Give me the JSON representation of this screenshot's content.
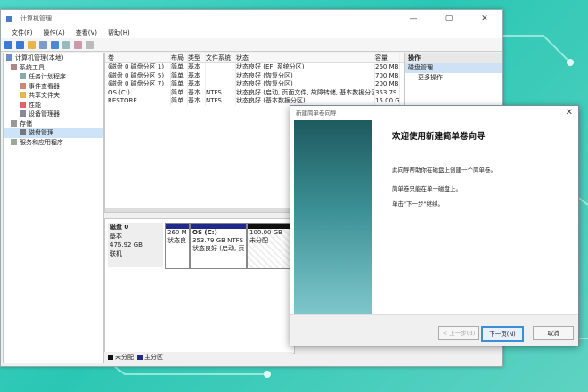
{
  "window": {
    "title": "计算机管理",
    "controls": [
      "—",
      "▢",
      "✕"
    ]
  },
  "menu": [
    "文件(F)",
    "操作(A)",
    "查看(V)",
    "帮助(H)"
  ],
  "tree": [
    {
      "label": "计算机管理(本地)",
      "level": 0,
      "icon": "computer-icon"
    },
    {
      "label": "系统工具",
      "level": 1,
      "icon": "tools-icon"
    },
    {
      "label": "任务计划程序",
      "level": 2,
      "icon": "clock-icon"
    },
    {
      "label": "事件查看器",
      "level": 2,
      "icon": "event-icon"
    },
    {
      "label": "共享文件夹",
      "level": 2,
      "icon": "folder-icon"
    },
    {
      "label": "性能",
      "level": 2,
      "icon": "performance-icon"
    },
    {
      "label": "设备管理器",
      "level": 2,
      "icon": "device-icon"
    },
    {
      "label": "存储",
      "level": 1,
      "icon": "storage-icon"
    },
    {
      "label": "磁盘管理",
      "level": 2,
      "icon": "disk-icon"
    },
    {
      "label": "服务和应用程序",
      "level": 1,
      "icon": "services-icon"
    }
  ],
  "volumes": {
    "headers": [
      "卷",
      "布局",
      "类型",
      "文件系统",
      "状态",
      "容量"
    ],
    "rows": [
      [
        "(磁盘 0 磁盘分区 1)",
        "简单",
        "基本",
        "",
        "状态良好 (EFI 系统分区)",
        "260 MB"
      ],
      [
        "(磁盘 0 磁盘分区 5)",
        "简单",
        "基本",
        "",
        "状态良好 (恢复分区)",
        "700 MB"
      ],
      [
        "(磁盘 0 磁盘分区 7)",
        "简单",
        "基本",
        "",
        "状态良好 (恢复分区)",
        "200 MB"
      ],
      [
        "OS (C:)",
        "简单",
        "基本",
        "NTFS",
        "状态良好 (启动, 页面文件, 故障转储, 基本数据分区)",
        "353.79 G"
      ],
      [
        "RESTORE",
        "简单",
        "基本",
        "NTFS",
        "状态良好 (基本数据分区)",
        "15.00 G"
      ]
    ]
  },
  "disk": {
    "name": "磁盘 0",
    "type": "基本",
    "size": "476.92 GB",
    "status": "联机",
    "partitions": [
      {
        "title": "",
        "size": "260 M",
        "status": "状态良"
      },
      {
        "title": "OS  (C:)",
        "size": "353.79 GB NTFS",
        "status": "状态良好 (启动, 页"
      },
      {
        "title": "",
        "size": "100.00 GB",
        "status": "未分配"
      }
    ]
  },
  "legend": [
    "未分配",
    "主分区"
  ],
  "actions": {
    "header": "操作",
    "section": "磁盘管理",
    "more": "更多操作"
  },
  "wizard": {
    "title": "新建简单卷向导",
    "heading": "欢迎使用新建简单卷向导",
    "p1": "此向导帮助你在磁盘上创建一个简单卷。",
    "p2": "简单卷只能在单一磁盘上。",
    "p3": "单击\"下一步\"继续。",
    "back": "< 上一步(B)",
    "next": "下一页(N)",
    "cancel": "取消"
  },
  "colors": {
    "primary_partition": "#1f2a8a",
    "unallocated": "#111111",
    "accent": "#3b8fd8"
  }
}
